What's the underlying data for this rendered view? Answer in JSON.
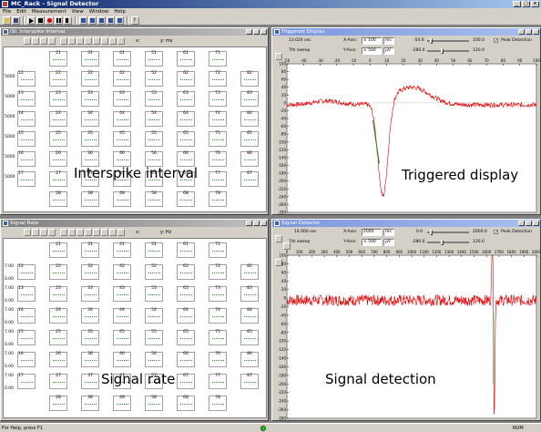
{
  "app": {
    "title": "MC_Rack - Signal Detector"
  },
  "menu": [
    "File",
    "Edit",
    "Measurement",
    "View",
    "Window",
    "Help"
  ],
  "windows": {
    "isi": {
      "title": "ISI: Interspike Interval",
      "x_label": "x:",
      "y_label": "y: ms",
      "caption": "Interspike interval",
      "y_ticks": [
        "5000",
        "5000",
        "5000",
        "5000",
        "5000",
        "5000"
      ],
      "row_labels": [
        "12",
        "13",
        "14",
        "15",
        "16",
        "17"
      ],
      "columns": [
        [
          "21",
          "22",
          "23",
          "24",
          "25",
          "26",
          "27",
          "28"
        ],
        [
          "31",
          "32",
          "33",
          "34",
          "35",
          "36",
          "37",
          "38"
        ],
        [
          "41",
          "42",
          "43",
          "44",
          "45",
          "46",
          "47",
          "48"
        ],
        [
          "51",
          "52",
          "53",
          "54",
          "55",
          "56",
          "57",
          "58"
        ],
        [
          "61",
          "62",
          "63",
          "64",
          "65",
          "66",
          "67",
          "68"
        ],
        [
          "71",
          "72",
          "73",
          "74",
          "75",
          "76",
          "77",
          "78"
        ],
        [
          "",
          "82",
          "83",
          "84",
          "85",
          "86",
          "87",
          ""
        ]
      ]
    },
    "rate": {
      "title": "Signal Rate",
      "x_label": "x:",
      "y_label": "y: Hz",
      "caption": "Signal rate",
      "y_ticks": [
        "7.00",
        "0.00",
        "7.00",
        "0.00",
        "7.00",
        "0.00",
        "7.00",
        "0.00",
        "7.00",
        "0.00",
        "7.00",
        "0.00"
      ],
      "row_labels": [
        "12",
        "13",
        "14",
        "15",
        "16",
        "17"
      ]
    },
    "triggered": {
      "title": "Triggered Display",
      "time": "13.024 sec",
      "sweep": "7th sweep",
      "x_axis_label": "X-Axis:",
      "x_axis_value": "± 100",
      "x_axis_unit": "ms",
      "y_axis_label": "Y-Axis:",
      "y_axis_value": "± 500",
      "y_axis_unit": "µV",
      "slider_x_min": "-54.0",
      "slider_x_max": "100.0",
      "slider_y_min": "-280.0",
      "slider_y_max": "120.0",
      "peak_detection": "Peak Detection",
      "caption": "Triggered display",
      "x_ticks": [
        "-50",
        "-40",
        "-30",
        "-20",
        "-10",
        "0",
        "10",
        "20",
        "30",
        "40",
        "50",
        "60",
        "70",
        "80",
        "90",
        "100"
      ],
      "y_ticks": [
        "100",
        "80",
        "60",
        "40",
        "20",
        "0",
        "-20",
        "-40",
        "-60",
        "-80",
        "-100",
        "-120",
        "-140",
        "-160",
        "-180",
        "-200",
        "-220",
        "-240",
        "-260",
        "-280"
      ]
    },
    "detector": {
      "title": "Signal Detector",
      "time": "14.000 sec",
      "sweep": "7th sweep",
      "x_axis_label": "X-Axis:",
      "x_axis_value": "2000",
      "x_axis_unit": "ms",
      "y_axis_label": "Y-Axis:",
      "y_axis_value": "± 500",
      "y_axis_unit": "µV",
      "slider_x_min": "0.0",
      "slider_x_max": "2000.0",
      "slider_y_min": "-280.0",
      "slider_y_max": "120.0",
      "peak_detection": "Peak Detection",
      "caption": "Signal detection",
      "x_ticks": [
        "0",
        "100",
        "200",
        "300",
        "400",
        "500",
        "600",
        "700",
        "800",
        "900",
        "1000",
        "1100",
        "1200",
        "1300",
        "1400",
        "1500",
        "1600",
        "1700",
        "1800",
        "1900",
        "2000"
      ],
      "y_ticks": [
        "100",
        "80",
        "60",
        "40",
        "20",
        "0",
        "-20",
        "-40",
        "-60",
        "-80",
        "-100",
        "-120",
        "-140",
        "-160",
        "-180",
        "-200",
        "-220",
        "-240",
        "-260",
        "-280"
      ]
    }
  },
  "status": {
    "help": "For Help, press F1",
    "num": "NUM"
  },
  "colors": {
    "trace": "#e00000",
    "spike_mark": "#208020",
    "grid_signal": "#3a8a3a"
  }
}
